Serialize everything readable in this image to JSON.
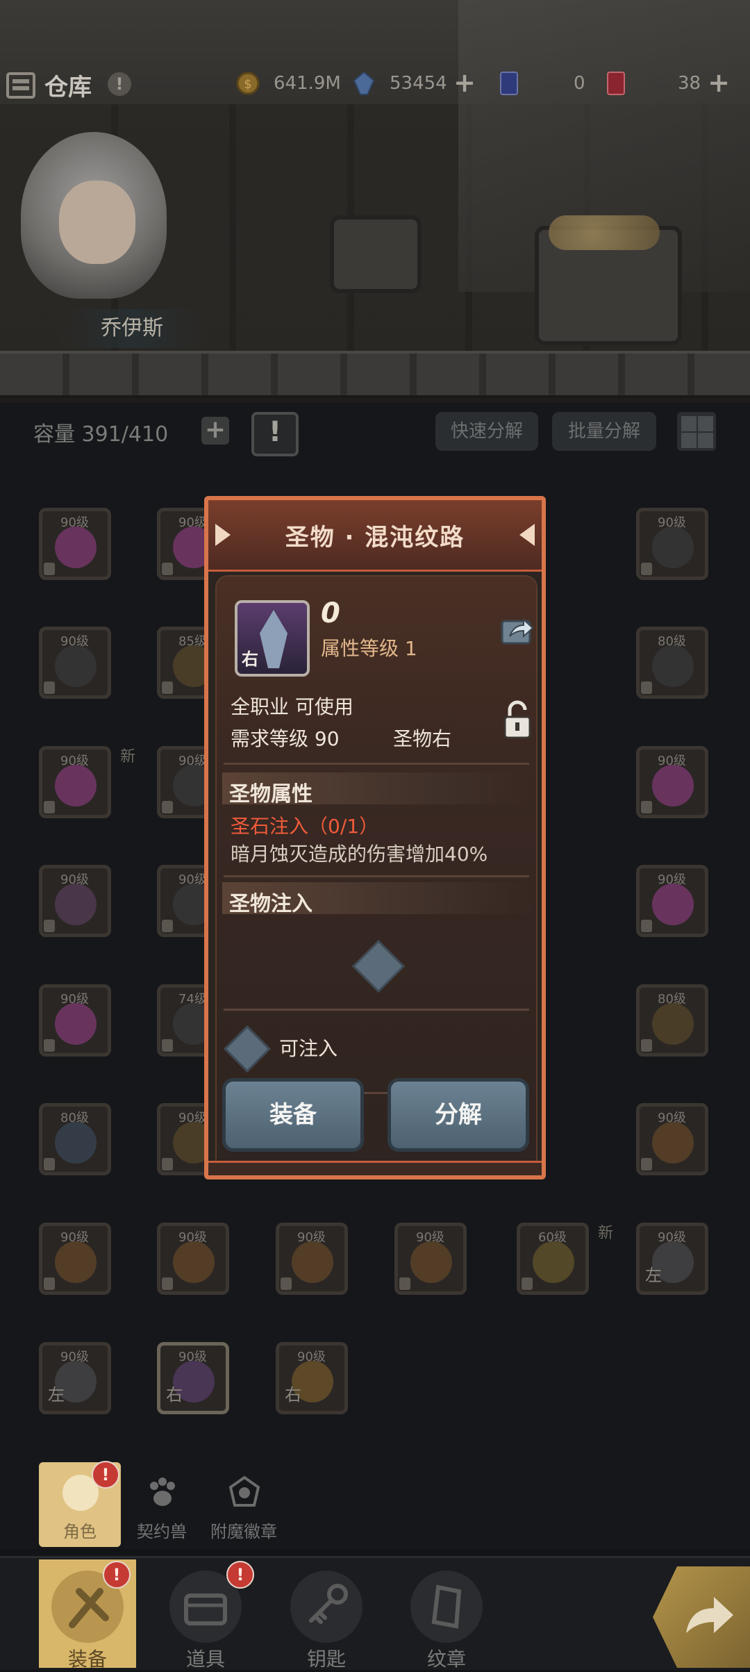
{
  "header": {
    "title": "仓库",
    "help": "!",
    "resources": [
      {
        "icon": "gold-coin-icon",
        "value": "641.9M"
      },
      {
        "icon": "blue-crystal-icon",
        "value": "53454"
      },
      {
        "icon": "blue-card-icon",
        "value": "0"
      },
      {
        "icon": "red-card-icon",
        "value": "38"
      }
    ],
    "plus": "+"
  },
  "character": {
    "name": "乔伊斯"
  },
  "toolbar": {
    "capacity_label": "容量",
    "capacity_value": "391/410",
    "plus": "+",
    "quick_decompose": "快速分解",
    "batch_decompose": "批量分解",
    "alert_icon": "!"
  },
  "inventory": {
    "level_labels": [
      "90级",
      "90级",
      "90级",
      "90级",
      "85级",
      "80级",
      "80级",
      "90级",
      "90级",
      "90级",
      "90级",
      "90级",
      "74级",
      "80级",
      "80级",
      "90级",
      "90级",
      "90级",
      "90级",
      "90级",
      "90级",
      "60级",
      "90级",
      "90级",
      "90级",
      "90级"
    ],
    "new_label": "新",
    "side_left": "左",
    "side_right": "右"
  },
  "modal": {
    "title": "圣物 · 混沌纹路",
    "enhance": "0",
    "attr_level": "属性等级 1",
    "icon_tag": "右",
    "job": "全职业 可使用",
    "req_level": "需求等级 90",
    "slot_type": "圣物右",
    "section_attr": "圣物属性",
    "attr_line1": "圣石注入（0/1）",
    "attr_line2": "暗月蚀灭造成的伤害增加40%",
    "section_inject": "圣物注入",
    "injectable": "可注入",
    "btn_equip": "装备",
    "btn_decompose": "分解"
  },
  "subtabs": [
    {
      "label": "角色",
      "badge": "!"
    },
    {
      "label": "契约兽"
    },
    {
      "label": "附魔徽章"
    }
  ],
  "nav": [
    {
      "label": "装备",
      "badge": "!"
    },
    {
      "label": "道具",
      "badge": "!"
    },
    {
      "label": "钥匙"
    },
    {
      "label": "纹章"
    }
  ],
  "colors": {
    "modal_border": "#d9754a",
    "warning_text": "#ef5b3a",
    "button_blue": "#5f7686",
    "nav_active": "#d9b76a"
  }
}
